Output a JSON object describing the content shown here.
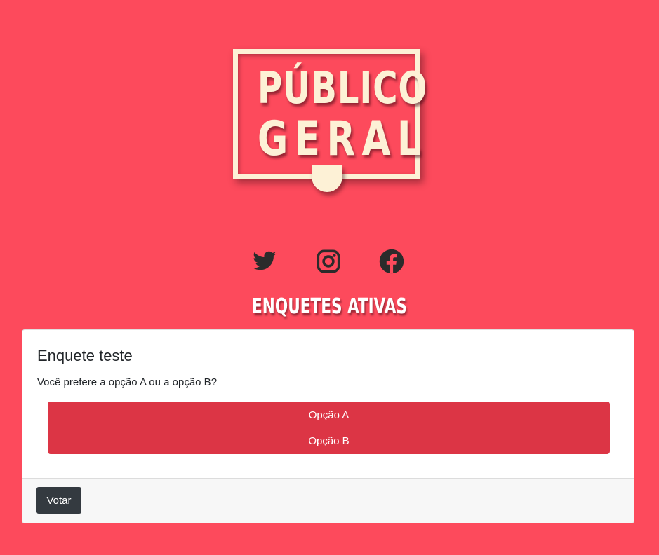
{
  "logo": {
    "line1": "PÚBLICO",
    "line2": "GERAL"
  },
  "social": {
    "icons": [
      "twitter-icon",
      "instagram-icon",
      "facebook-icon"
    ],
    "icon_color": "#2b2b2b"
  },
  "section_title": "ENQUETES ATIVAS",
  "poll": {
    "title": "Enquete teste",
    "question": "Você prefere a opção A ou a opção B?",
    "options": [
      "Opção A",
      "Opção B"
    ],
    "vote_label": "Votar"
  },
  "colors": {
    "background": "#fd4a5c",
    "option_bg": "#dc3545",
    "button_bg": "#343a40",
    "logo_color": "#fdf1d6"
  }
}
